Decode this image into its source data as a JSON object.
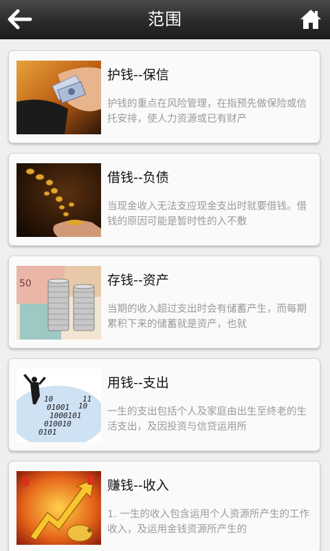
{
  "header": {
    "title": "范围",
    "back_icon": "arrow-left-icon",
    "home_icon": "home-icon"
  },
  "items": [
    {
      "title": "护钱--保信",
      "desc": "护钱的重点在风险管理，在指预先做保险或信托安排，使人力资源或已有财产",
      "image": "hand-with-banknotes-wallet"
    },
    {
      "title": "借钱--负债",
      "desc": "当现金收入无法支应现金支出时就要借钱。借钱的原因可能是暂时性的入不敷",
      "image": "coins-falling-into-hand"
    },
    {
      "title": "存钱--资产",
      "desc": "当期的收入超过支出时会有储蓄产生，而每期累积下来的储蓄就是资产，也就",
      "image": "coin-stacks-on-banknotes"
    },
    {
      "title": "用钱--支出",
      "desc": "一生的支出包括个人及家庭由出生至终老的生活支出，及因投资与信贷运用所",
      "image": "businessman-binary-digits"
    },
    {
      "title": "赚钱--收入",
      "desc": "1. 一生的收入包含运用个人资源所产生的工作收入，及运用金钱资源所产生的",
      "image": "golden-rising-arrow-piggy-bank"
    }
  ]
}
